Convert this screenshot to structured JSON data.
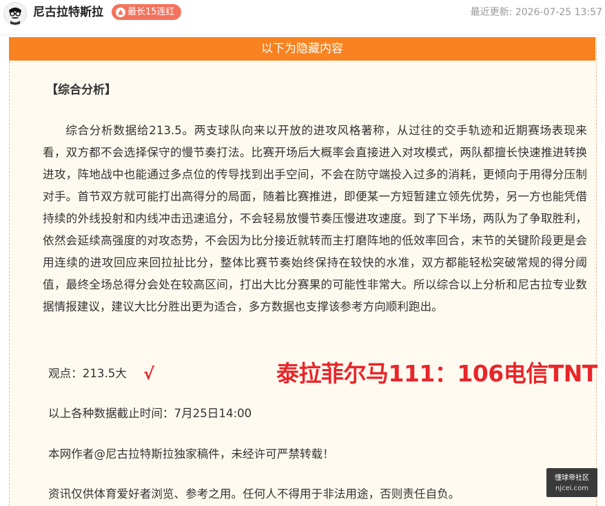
{
  "header": {
    "author": "尼古拉特斯拉",
    "badge": "最长15连红",
    "updated_label": "最近更新:",
    "updated_time": "2026-07-25 13:57"
  },
  "hidden_bar": "以下为隐藏内容",
  "section_title": "【综合分析】",
  "analysis": "综合分析数据给213.5。两支球队向来以开放的进攻风格著称，从过往的交手轨迹和近期赛场表现来看，双方都不会选择保守的慢节奏打法。比赛开场后大概率会直接进入对攻模式，两队都擅长快速推进转换进攻，阵地战中也能通过多点位的传导找到出手空间，不会在防守端投入过多的消耗，更倾向于用得分压制对手。首节双方就可能打出高得分的局面，随着比赛推进，即便某一方短暂建立领先优势，另一方也能凭借持续的外线投射和内线冲击迅速追分，不会轻易放慢节奏压慢进攻速度。到了下半场，两队为了争取胜利，依然会延续高强度的对攻态势，不会因为比分接近就转而主打磨阵地的低效率回合，末节的关键阶段更是会用连续的进攻回应来回拉扯比分，整体比赛节奏始终保持在较快的水准，双方都能轻松突破常规的得分阈值，最终全场总得分会处在较高区间，打出大比分赛果的可能性非常大。所以综合以上分析和尼古拉专业数据情报建议，建议大比分胜出更为适合，多方数据也支撑该参考方向顺利跑出。",
  "opinion": "观点：213.5大",
  "check_mark": "√",
  "result": "泰拉菲尔马111：106电信TNT",
  "cutoff": "以上各种数据截止时间：7月25日14:00",
  "copyright": "本网作者@尼古拉特斯拉独家稿件，未经许可严禁转载！",
  "disclaimer": "资讯仅供体育爱好者浏览、参考之用。任何人不得用于非法用途，否则责任自负。",
  "watermark": {
    "top": "懂球帝社区",
    "bottom": "njcei.com"
  }
}
